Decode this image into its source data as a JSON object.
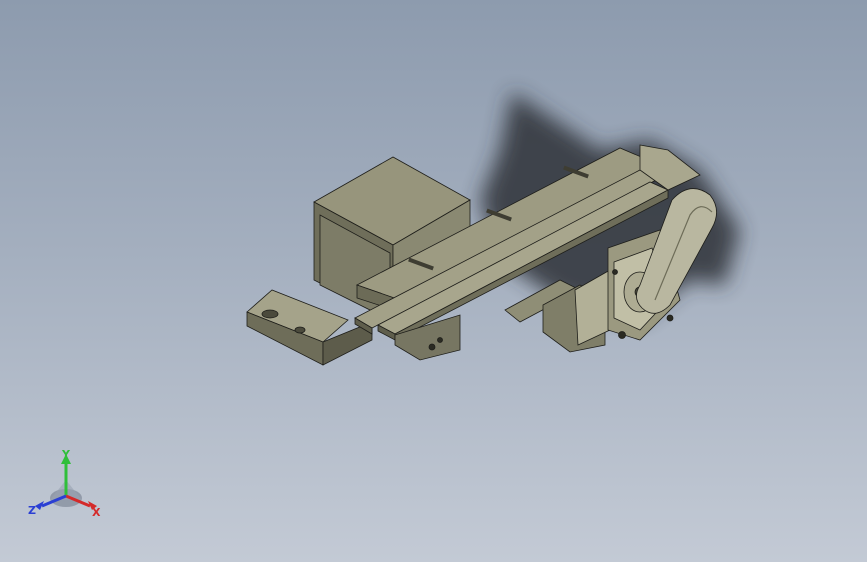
{
  "viewport": {
    "background_top": "#8d9bae",
    "background_bottom": "#c3cad5"
  },
  "model": {
    "body_color": "#8c8b73",
    "shadow_color": "#2f3338",
    "edge_color": "#1e1e1a"
  },
  "triad": {
    "x_label": "X",
    "y_label": "Y",
    "z_label": "Z",
    "x_color": "#d42a2a",
    "y_color": "#2fbf3a",
    "z_color": "#2a3fd4"
  }
}
